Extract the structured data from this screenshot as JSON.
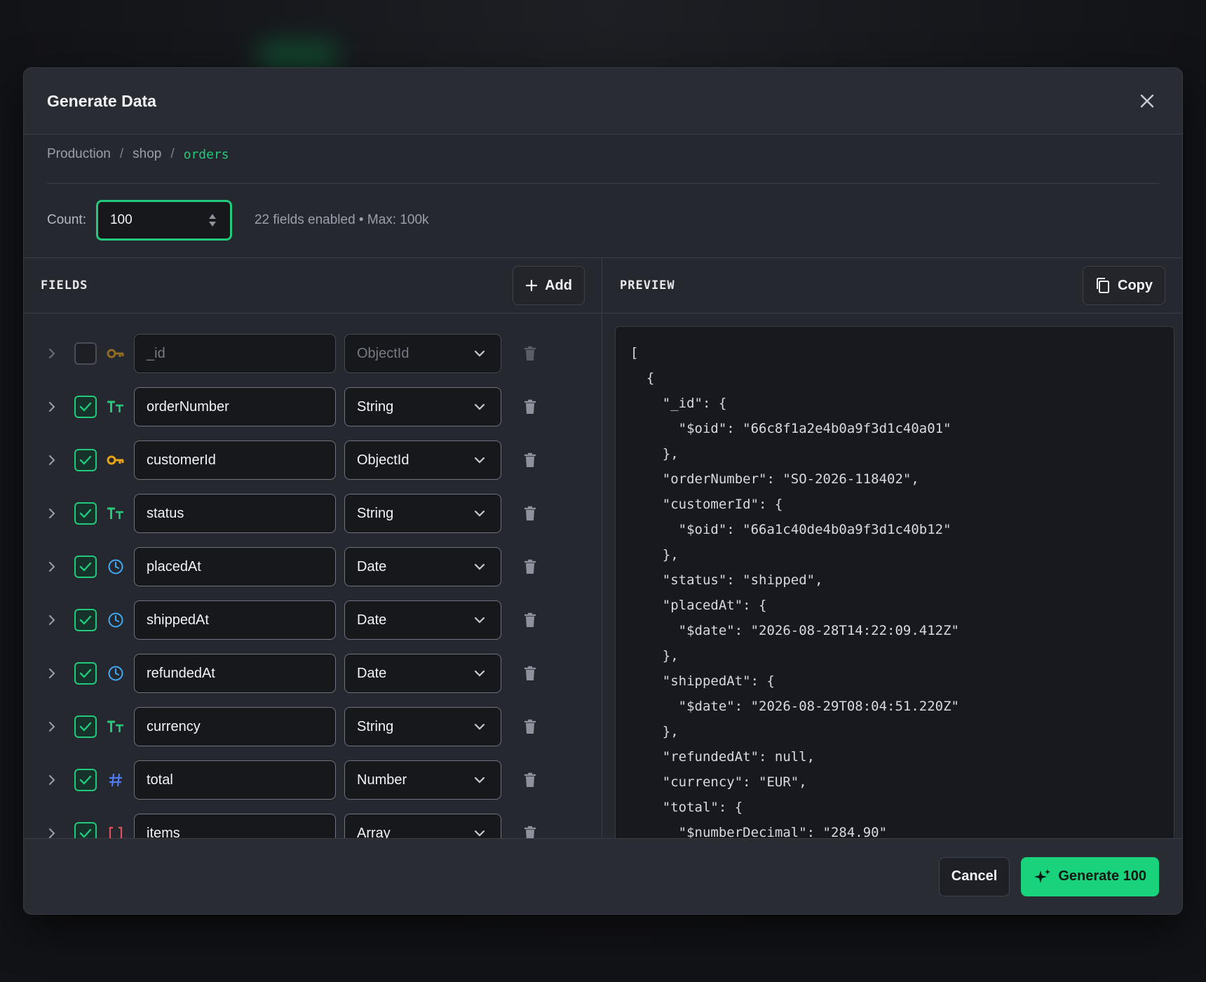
{
  "modal": {
    "title": "Generate Data"
  },
  "breadcrumb": [
    "Production",
    "shop",
    "orders"
  ],
  "count": {
    "label": "Count:",
    "value": "100",
    "meta": "22 fields enabled • Max: 100k"
  },
  "fields_pane": {
    "title": "FIELDS",
    "add_label": "Add",
    "rows": [
      {
        "name": "_id",
        "type": "ObjectId",
        "icon": "key-icon",
        "enabled": false
      },
      {
        "name": "orderNumber",
        "type": "String",
        "icon": "text-type-icon",
        "enabled": true
      },
      {
        "name": "customerId",
        "type": "ObjectId",
        "icon": "key-icon",
        "enabled": true
      },
      {
        "name": "status",
        "type": "String",
        "icon": "text-type-icon",
        "enabled": true
      },
      {
        "name": "placedAt",
        "type": "Date",
        "icon": "clock-icon",
        "enabled": true
      },
      {
        "name": "shippedAt",
        "type": "Date",
        "icon": "clock-icon",
        "enabled": true
      },
      {
        "name": "refundedAt",
        "type": "Date",
        "icon": "clock-icon",
        "enabled": true
      },
      {
        "name": "currency",
        "type": "String",
        "icon": "text-type-icon",
        "enabled": true
      },
      {
        "name": "total",
        "type": "Number",
        "icon": "hash-icon",
        "enabled": true
      },
      {
        "name": "items",
        "type": "Array",
        "icon": "brackets-icon",
        "enabled": true
      }
    ]
  },
  "preview_pane": {
    "title": "PREVIEW",
    "copy_label": "Copy",
    "code": "[\n  {\n    \"_id\": {\n      \"$oid\": \"66c8f1a2e4b0a9f3d1c40a01\"\n    },\n    \"orderNumber\": \"SO-2026-118402\",\n    \"customerId\": {\n      \"$oid\": \"66a1c40de4b0a9f3d1c40b12\"\n    },\n    \"status\": \"shipped\",\n    \"placedAt\": {\n      \"$date\": \"2026-08-28T14:22:09.412Z\"\n    },\n    \"shippedAt\": {\n      \"$date\": \"2026-08-29T08:04:51.220Z\"\n    },\n    \"refundedAt\": null,\n    \"currency\": \"EUR\",\n    \"total\": {\n      \"$numberDecimal\": \"284.90\""
  },
  "footer": {
    "cancel_label": "Cancel",
    "generate_label": "Generate 100"
  },
  "colors": {
    "accent": "#22c97a",
    "key_icon": "#e8a317",
    "clock_icon": "#3fa9f5",
    "hash_icon": "#4f7cf0",
    "array_icon": "#e0525b"
  }
}
